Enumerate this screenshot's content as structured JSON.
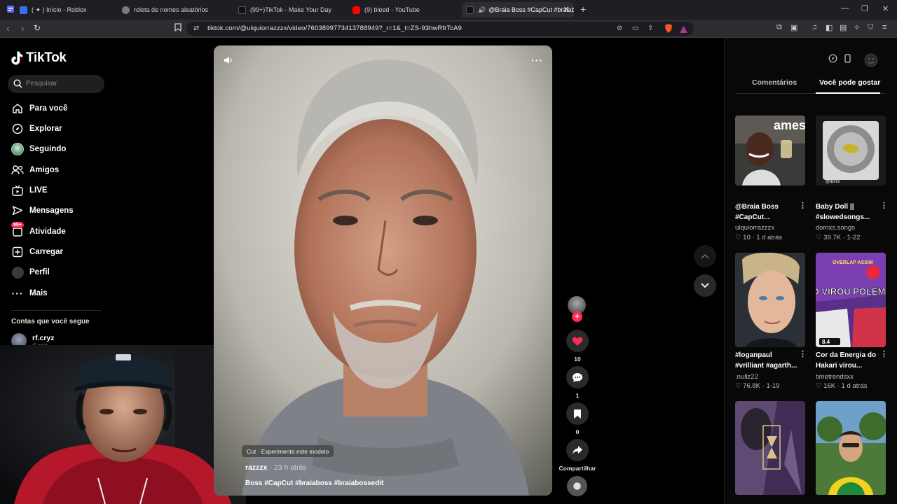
{
  "browser": {
    "tabs": [
      {
        "title": "( ✦ ) Início - Roblox",
        "favicon_color": "#3b6df0"
      },
      {
        "title": "roleta de nomes aleatórios",
        "favicon_color": "#7a7a80"
      },
      {
        "title": "(99+)TikTok - Make Your Day",
        "favicon_color": "#111111"
      },
      {
        "title": "(9) bleed - YouTube",
        "favicon_color": "#ff0000"
      },
      {
        "title": "@Braia Boss #CapCut #braiab",
        "favicon_color": "#111111"
      }
    ],
    "url": "tiktok.com/@ulquiorrazzzx/video/7603899773413788949?_r=1&_t=ZS-93hwRfrTcA9"
  },
  "tiktok": {
    "logo_text": "TikTok",
    "search_placeholder": "Pesquisar",
    "nav": [
      {
        "label": "Para você",
        "icon": "home-icon"
      },
      {
        "label": "Explorar",
        "icon": "compass-icon"
      },
      {
        "label": "Seguindo",
        "icon": "following-avatar-icon"
      },
      {
        "label": "Amigos",
        "icon": "friends-icon"
      },
      {
        "label": "LIVE",
        "icon": "live-icon"
      },
      {
        "label": "Mensagens",
        "icon": "message-icon"
      },
      {
        "label": "Atividade",
        "icon": "activity-icon",
        "badge": "99+"
      },
      {
        "label": "Carregar",
        "icon": "upload-icon"
      },
      {
        "label": "Perfil",
        "icon": "profile-icon"
      },
      {
        "label": "Mais",
        "icon": "more-icon"
      }
    ],
    "following_title": "Contas que você segue",
    "following": [
      {
        "name": "rf.cryz",
        "sub": "rf.cryz"
      }
    ]
  },
  "video": {
    "template_tag": "Cut · Experimenta este modelo",
    "author": "razzzx",
    "time": "23 h atrás",
    "caption": "Boss #CapCut #braiaboss #braiabossedit",
    "likes": "10",
    "comments": "1",
    "saves": "0",
    "share_label": "Compartilhar",
    "accent": "#fe2c55"
  },
  "right_panel": {
    "tabs": [
      "Comentários",
      "Você pode gostar"
    ],
    "active_tab": "Você pode gostar",
    "cards": [
      {
        "title": "@Braia Boss #CapCut...",
        "author": "ulquiorrazzzx",
        "likes": "10",
        "age": "1 d atrás"
      },
      {
        "title": "Baby Doll || #slowedsongs...",
        "author": "domxs.songs",
        "likes": "39.7K",
        "age": "1-22"
      },
      {
        "title": "#loganpaul #vrilliant #agarth...",
        "author": ".nullz22",
        "likes": "76.8K",
        "age": "1-19"
      },
      {
        "title": "Cor da Energia do Hakari virou...",
        "author": "timetrendsxx",
        "likes": "16K",
        "age": "1 d atrás"
      }
    ],
    "thumb_text": {
      "c1": "ames",
      "c2": "@domx",
      "c4_top": "OVERLAP ASSIM",
      "c4_main": "ISSO VIROU POLÊMICA!",
      "c4_score": "8.4"
    }
  }
}
